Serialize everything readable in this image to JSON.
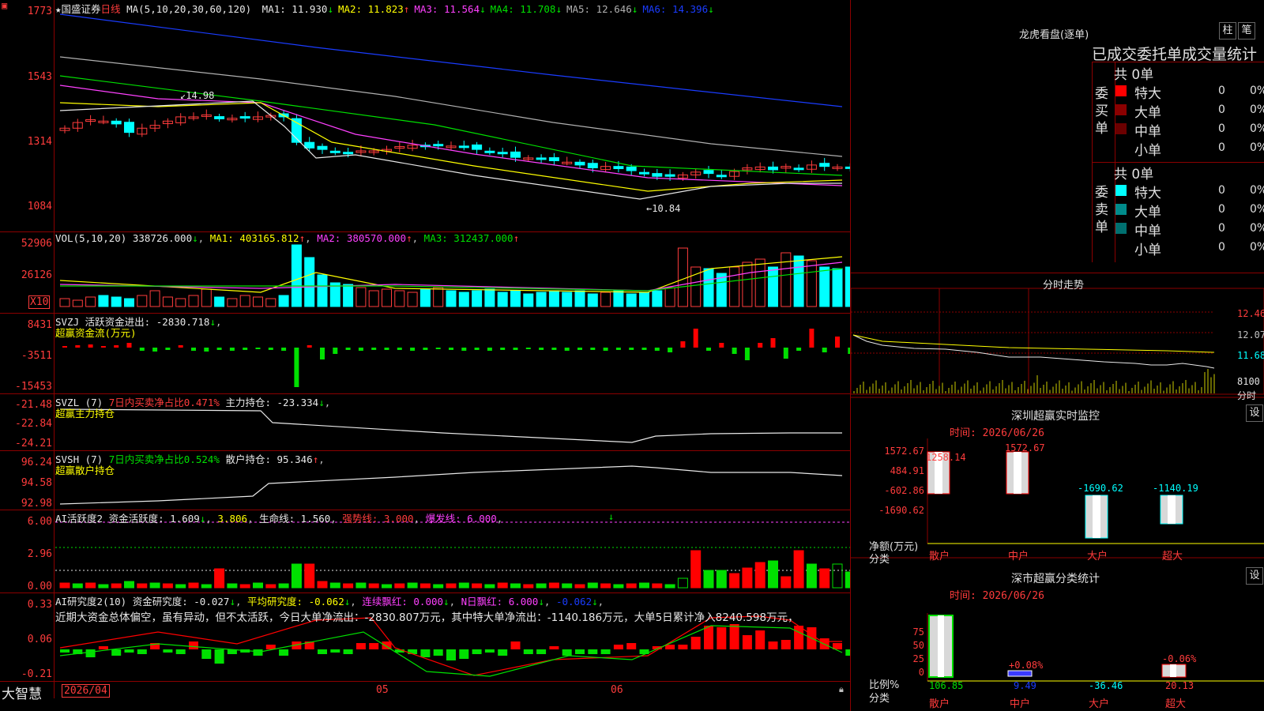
{
  "stock": {
    "name": "国盛证券",
    "period": "日线",
    "ma_params": "MA(5,10,20,30,60,120)"
  },
  "ma_legend": [
    {
      "label": "MA1: 11.930",
      "arrow": "↓",
      "color": "#e8e8e8"
    },
    {
      "label": "MA2: 11.823",
      "arrow": "↑",
      "color": "#ffff00"
    },
    {
      "label": "MA3: 11.564",
      "arrow": "↓",
      "color": "#ff40ff"
    },
    {
      "label": "MA4: 11.708",
      "arrow": "↓",
      "color": "#00e000"
    },
    {
      "label": "MA5: 12.646",
      "arrow": "↓",
      "color": "#b0b0b0"
    },
    {
      "label": "MA6: 14.396",
      "arrow": "↓",
      "color": "#1a3cff"
    }
  ],
  "price_axis": [
    "1773",
    "1543",
    "1314",
    "1084"
  ],
  "price_annotations": {
    "high": "14.98",
    "low": "10.84"
  },
  "vol": {
    "params": "VOL(5,10,20)",
    "value": "338726.000",
    "ma1": "MA1: 403165.812",
    "ma2": "MA2: 380570.000",
    "ma3": "MA3: 312437.000",
    "axis": [
      "52906",
      "26126"
    ],
    "unit": "X10"
  },
  "svzj": {
    "name": "SVZJ",
    "desc": "活跃资金进出: -2830.718",
    "sub": "超赢资金流(万元)",
    "axis": [
      "8431",
      "-3511",
      "-15453"
    ]
  },
  "svzl": {
    "name": "SVZL (7)",
    "desc": "7日内买卖净占比0.471%",
    "holding": "主力持仓: -23.334",
    "sub": "超赢主力持仓",
    "axis": [
      "-21.48",
      "-22.84",
      "-24.21"
    ]
  },
  "svsh": {
    "name": "SVSH (7)",
    "desc": "7日内买卖净占比0.524%",
    "holding": "散户持仓: 95.346",
    "sub": "超赢散户持仓",
    "axis": [
      "96.24",
      "94.58",
      "92.98"
    ]
  },
  "ai1": {
    "name": "AI活跃度2",
    "a": "资金活跃度: 1.609",
    "b": "3.806",
    "c": "生命线: 1.560",
    "d": "强势线: 3.000",
    "e": "爆发线: 6.000",
    "axis": [
      "6.00",
      "2.96",
      "0.00"
    ]
  },
  "ai2": {
    "name": "AI研究度2(10)",
    "a": "资金研究度: -0.027",
    "b": "平均研究度: -0.062",
    "c": "连续飘红: 0.000",
    "d": "N日飘红: 6.000",
    "e": "-0.062",
    "text": "近期大资金总体偏空，虽有异动，但不太活跃，今日大单净流出：-2830.807万元，其中特大单净流出：-1140.186万元，大单5日累计净入8240.598万元，",
    "axis": [
      "0.33",
      "0.06",
      "-0.21"
    ]
  },
  "dates": [
    "2026/04",
    "05",
    "06"
  ],
  "brand": "大智慧",
  "lhb": {
    "title": "龙虎看盘(逐单)",
    "btn1": "柱",
    "btn2": "笔",
    "heading": "已成交委托单成交量统计",
    "buy_label": "委买单",
    "sell_label": "委卖单",
    "buy_total": "共 0单",
    "sell_total": "共 0单",
    "buy_rows": [
      {
        "name": "特大",
        "v": "0",
        "p": "0%",
        "color": "#ff0000"
      },
      {
        "name": "大单",
        "v": "0",
        "p": "0%",
        "color": "#8b0000"
      },
      {
        "name": "中单",
        "v": "0",
        "p": "0%",
        "color": "#6b0000"
      },
      {
        "name": "小单",
        "v": "0",
        "p": "0%",
        "color": ""
      }
    ],
    "sell_rows": [
      {
        "name": "特大",
        "v": "0",
        "p": "0%",
        "color": "#00ffff"
      },
      {
        "name": "大单",
        "v": "0",
        "p": "0%",
        "color": "#008b8b"
      },
      {
        "name": "中单",
        "v": "0",
        "p": "0%",
        "color": "#007070"
      },
      {
        "name": "小单",
        "v": "0",
        "p": "0%",
        "color": ""
      }
    ]
  },
  "intraday": {
    "title": "分时走势",
    "axis": [
      "12.46",
      "12.07",
      "11.68"
    ],
    "vol_axis": "8100",
    "vol_unit": "分时"
  },
  "monitor": {
    "title": "深圳超赢实时监控",
    "btn": "设",
    "time": "时间: 2026/06/26",
    "axis": [
      "1572.67",
      "484.91",
      "-602.86",
      "-1690.62"
    ],
    "ylabel": "净额(万元)",
    "xlabel": "分类",
    "cats": [
      "散户",
      "中户",
      "大户",
      "超大"
    ],
    "vals": [
      "1258.14",
      "1572.67",
      "-1690.62",
      "-1140.19"
    ]
  },
  "classify": {
    "title": "深市超赢分类统计",
    "btn": "设",
    "time": "时间: 2026/06/26",
    "axis": [
      "75",
      "50",
      "25",
      "0"
    ],
    "ylabel": "比例%",
    "xlabel": "分类",
    "cats": [
      "散户",
      "中户",
      "大户",
      "超大"
    ],
    "vals": [
      "106.85",
      "9.49",
      "-36.46",
      "20.13"
    ],
    "tops": [
      "",
      "+0.08%",
      "",
      "-0.06%"
    ]
  },
  "colors": {
    "up": "#ff3c3c",
    "down": "#00ffff",
    "frame": "#8b0000"
  }
}
